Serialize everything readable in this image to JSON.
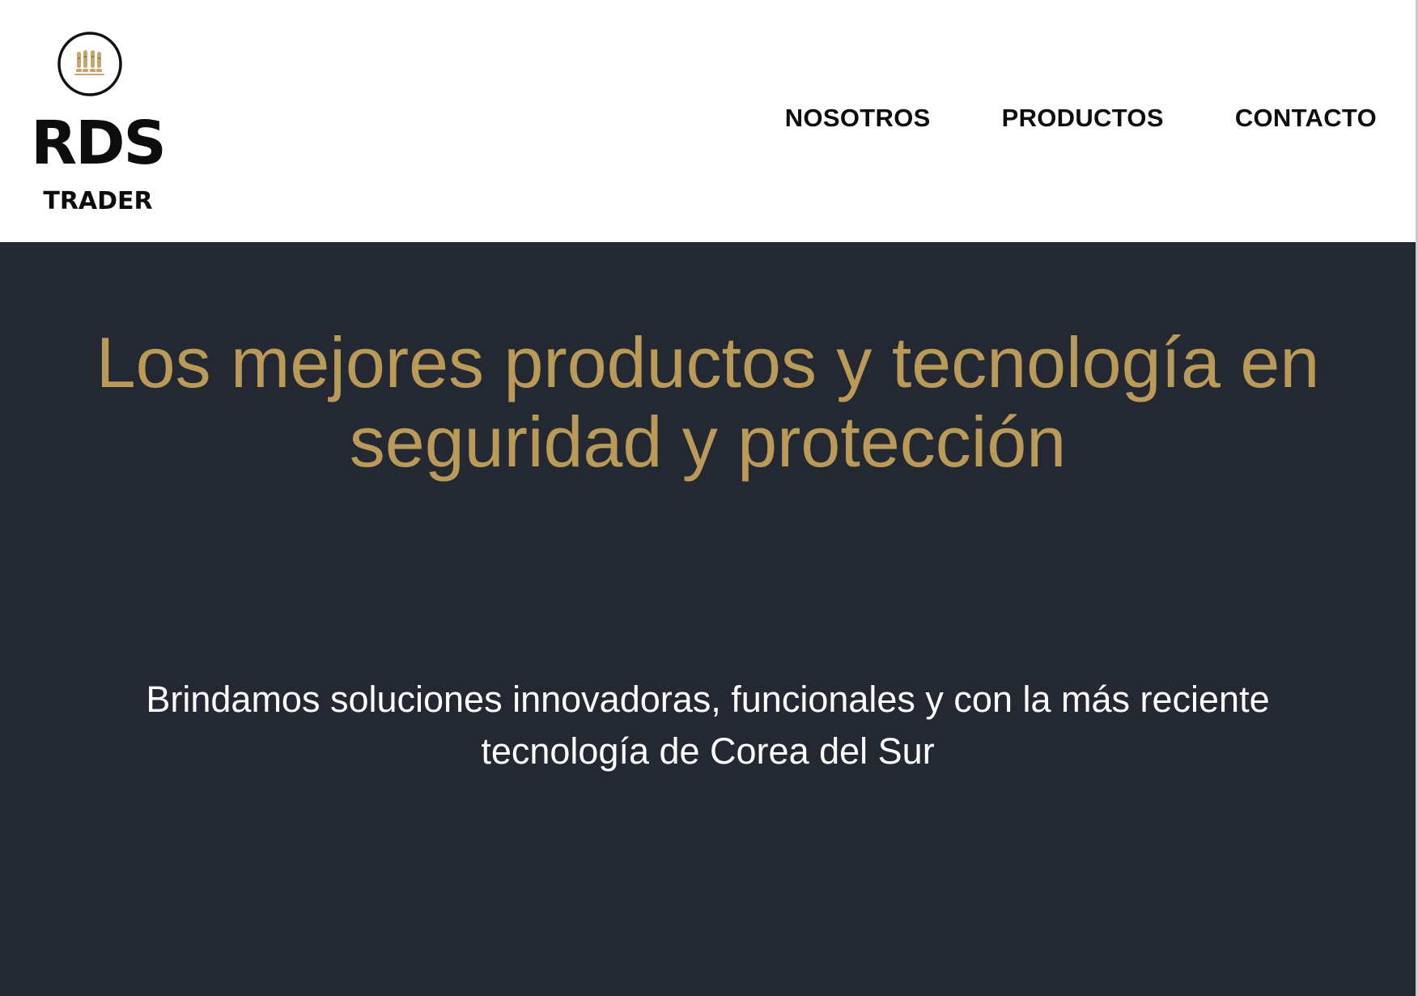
{
  "header": {
    "logo": {
      "name": "RDS",
      "subtitle": "TRADER",
      "emblem_icon": "bullets-emblem-icon"
    },
    "nav": [
      {
        "label": "NOSOTROS"
      },
      {
        "label": "PRODUCTOS"
      },
      {
        "label": "CONTACTO"
      }
    ]
  },
  "hero": {
    "title": "Los mejores productos y tecnología en seguridad y protección",
    "subtitle": "Brindamos soluciones innovadoras, funcionales y con la más reciente tecnología de Corea del Sur"
  },
  "colors": {
    "accent_gold": "#b99a57",
    "hero_background": "#242832",
    "header_background": "#ffffff",
    "text_dark": "#0d0d0d"
  }
}
